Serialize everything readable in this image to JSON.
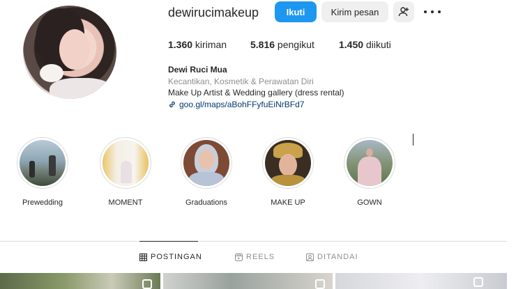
{
  "profile": {
    "username": "dewirucimakeup",
    "follow_label": "Ikuti",
    "message_label": "Kirim pesan",
    "add_user_icon": "add-user-icon",
    "more_icon": "more-icon"
  },
  "stats": {
    "posts_value": "1.360",
    "posts_label": " kiriman",
    "followers_value": "5.816",
    "followers_label": " pengikut",
    "following_value": "1.450",
    "following_label": " diikuti"
  },
  "bio": {
    "name": "Dewi Ruci Mua",
    "category": "Kecantikan, Kosmetik & Perawatan Diri",
    "description": "Make Up Artist & Wedding gallery (dress rental)",
    "link": "goo.gl/maps/aBohFFyfuEiNrBFd7"
  },
  "highlights": [
    {
      "label": "Prewedding"
    },
    {
      "label": "MOMENT"
    },
    {
      "label": "Graduations"
    },
    {
      "label": "MAKE UP"
    },
    {
      "label": "GOWN"
    }
  ],
  "tabs": {
    "posts": "POSTINGAN",
    "reels": "REELS",
    "tagged": "DITANDAI"
  },
  "colors": {
    "accent": "#1d97f0",
    "link": "#00376b",
    "muted": "#8e8e8e"
  }
}
